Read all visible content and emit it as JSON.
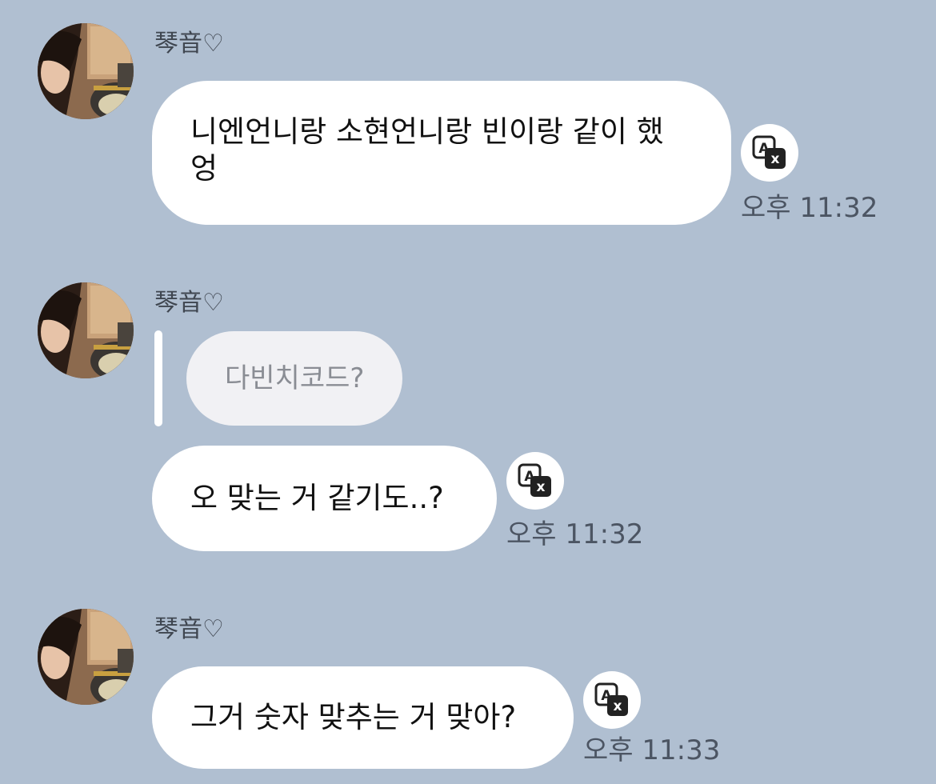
{
  "messages": [
    {
      "sender": "琴音♡",
      "text_line1": "니엔언니랑 소현언니랑 빈이랑 같이 했",
      "text_line2": "엉",
      "time": "오후 11:32"
    },
    {
      "sender": "琴音♡",
      "quote": "다빈치코드?",
      "text": "오 맞는 거 같기도..?",
      "time": "오후 11:32"
    },
    {
      "sender": "琴音♡",
      "text": "그거 숫자 맞추는 거 맞아?",
      "time": "오후 11:33"
    }
  ],
  "icons": {
    "avatar": "profile-photo",
    "translate": "translate-icon"
  },
  "colors": {
    "background": "#B0BFD1",
    "bubble": "#FFFFFF",
    "quote_bubble": "#F1F1F4"
  }
}
